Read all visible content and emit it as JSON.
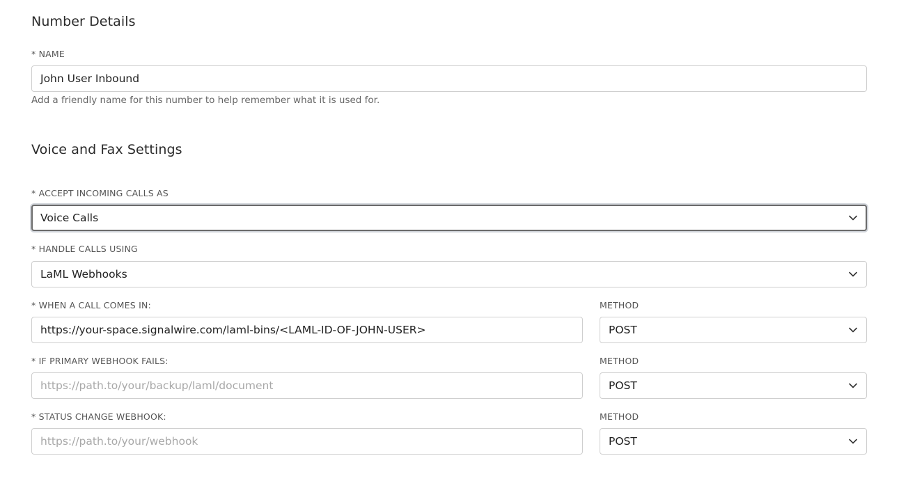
{
  "number_details": {
    "title": "Number Details",
    "name_label": "* NAME",
    "name_value": "John User Inbound",
    "name_help": "Add a friendly name for this number to help remember what it is used for."
  },
  "voice_fax": {
    "title": "Voice and Fax Settings",
    "accept_label": "* ACCEPT INCOMING CALLS AS",
    "accept_value": "Voice Calls",
    "handle_label": "* HANDLE CALLS USING",
    "handle_value": "LaML Webhooks",
    "call_comes_in_label": "* WHEN A CALL COMES IN:",
    "call_comes_in_value": "https://your-space.signalwire.com/laml-bins/<LAML-ID-OF-JOHN-USER>",
    "method_label_1": "METHOD",
    "method_value_1": "POST",
    "primary_fails_label": "* IF PRIMARY WEBHOOK FAILS:",
    "primary_fails_placeholder": "https://path.to/your/backup/laml/document",
    "method_label_2": "METHOD",
    "method_value_2": "POST",
    "status_change_label": "* STATUS CHANGE WEBHOOK:",
    "status_change_placeholder": "https://path.to/your/webhook",
    "method_label_3": "METHOD",
    "method_value_3": "POST"
  },
  "icons": {
    "dropdown": "chevron-down-icon"
  }
}
